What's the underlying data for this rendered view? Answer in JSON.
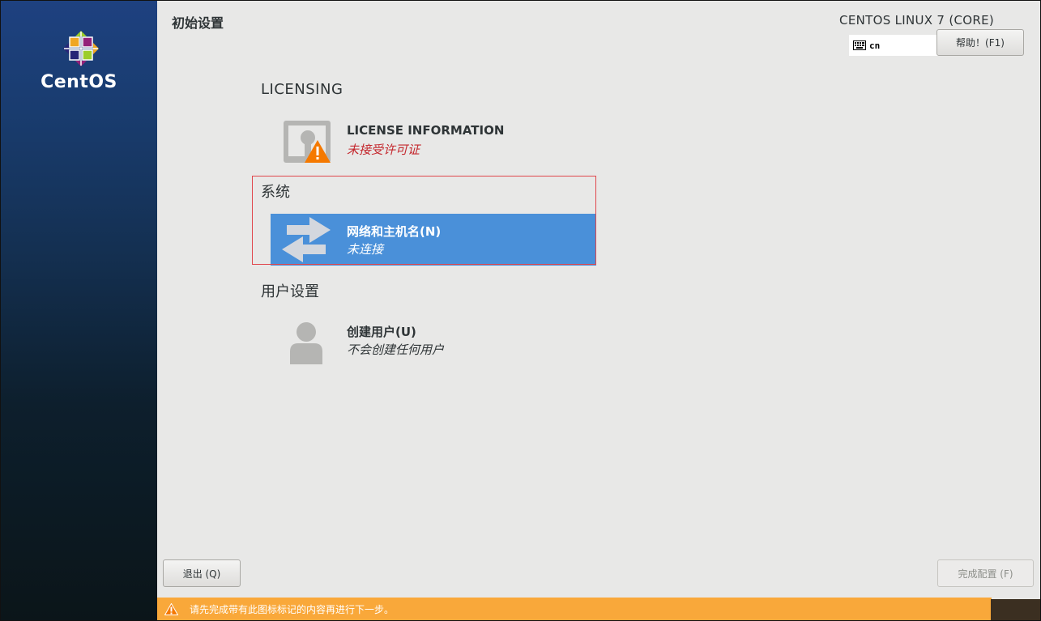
{
  "sidebar": {
    "brand_text": "CentOS"
  },
  "header": {
    "title": "初始设置",
    "product": "CENTOS LINUX 7 (CORE)",
    "keyboard_layout": "cn",
    "help_label": "帮助！(F1)"
  },
  "sections": {
    "licensing": {
      "title": "LICENSING",
      "spoke": {
        "title": "LICENSE INFORMATION",
        "status": "未接受许可证",
        "icon": "license-warning-icon"
      }
    },
    "system": {
      "title": "系统",
      "spoke": {
        "title": "网络和主机名(N)",
        "status": "未连接",
        "icon": "network-arrows-icon"
      }
    },
    "user_settings": {
      "title": "用户设置",
      "spoke": {
        "title": "创建用户(U)",
        "status": "不会创建任何用户",
        "icon": "user-icon"
      }
    }
  },
  "footer": {
    "quit_label": "退出 (Q)",
    "finish_label": "完成配置 (F)",
    "warning_text": "请先完成带有此图标标记的内容再进行下一步。"
  },
  "colors": {
    "selected_spoke": "#4a90d9",
    "warning_bar": "#f9a83a",
    "status_error": "#c4272d",
    "highlight_border": "#e0474c"
  }
}
